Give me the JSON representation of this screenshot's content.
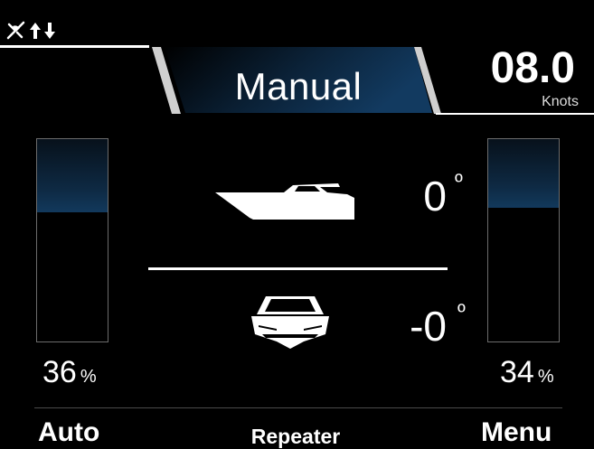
{
  "status": {
    "icons": [
      "gps-off-icon",
      "up-arrow-icon",
      "down-arrow-icon"
    ]
  },
  "header": {
    "mode_label": "Manual",
    "speed_value": "08.0",
    "speed_unit": "Knots"
  },
  "gauges": {
    "left": {
      "percent_text": "36",
      "percent_sign": "%",
      "fill_fraction": 0.36
    },
    "right": {
      "percent_text": "34",
      "percent_sign": "%",
      "fill_fraction": 0.34
    }
  },
  "attitude": {
    "trim_angle": "0",
    "list_angle": "-0",
    "degree_symbol": "º"
  },
  "softkeys": {
    "left": "Auto",
    "center": "Repeater",
    "right": "Menu"
  },
  "colors": {
    "background": "#000000",
    "accent_blue": "#12395c",
    "text": "#ffffff",
    "gauge_border": "#6c6c6c"
  }
}
